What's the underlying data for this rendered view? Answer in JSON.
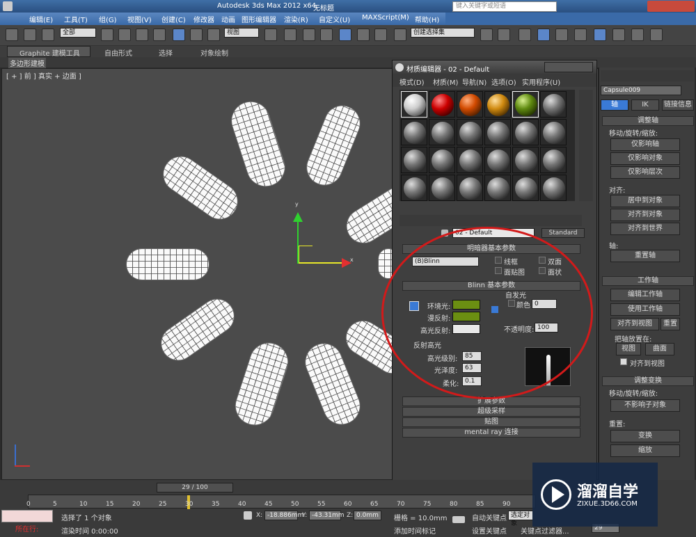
{
  "title": {
    "app": "Autodesk 3ds Max  2012 x64",
    "file": "无标题",
    "search_placeholder": "键入关键字或短语"
  },
  "menu": [
    "编辑(E)",
    "工具(T)",
    "组(G)",
    "视图(V)",
    "创建(C)",
    "修改器",
    "动画",
    "图形编辑器",
    "渲染(R)",
    "自定义(U)",
    "MAXScript(M)",
    "帮助(H)"
  ],
  "toolbar": {
    "selection_filter": "全部",
    "ref_coord": "视图",
    "named_selection": "创建选择集"
  },
  "ribbon": {
    "tabs": [
      "Graphite 建模工具",
      "自由形式",
      "选择",
      "对象绘制"
    ],
    "sub": "多边形建模"
  },
  "viewport": {
    "label": "[ + ] 前 ] 真实 + 边面 ]",
    "axis_x": "x",
    "axis_y": "y"
  },
  "mat_editor": {
    "title": "材质编辑器 - 02 - Default",
    "menu": [
      "模式(D)",
      "材质(M)",
      "导航(N)",
      "选项(O)",
      "实用程序(U)"
    ],
    "material_name": "02 - Default",
    "material_type": "Standard",
    "shader_rollout": "明暗器基本参数",
    "shader": "(B)Blinn",
    "wire": "线框",
    "two_sided": "双面",
    "face_map": "面贴图",
    "faceted": "面状",
    "blinn_rollout": "Blinn 基本参数",
    "self_illum": "自发光",
    "color": "颜色",
    "self_illum_value": "0",
    "ambient": "环境光:",
    "diffuse": "漫反射:",
    "specular": "高光反射:",
    "opacity_label": "不透明度:",
    "opacity": "100",
    "spec_highlights": "反射高光",
    "spec_level_label": "高光级别:",
    "spec_level": "85",
    "glossiness_label": "光泽度:",
    "glossiness": "63",
    "soften_label": "柔化:",
    "soften": "0.1",
    "rollouts": [
      "扩展参数",
      "超级采样",
      "贴图",
      "mental ray 连接"
    ],
    "ambient_color": "#6b8f12",
    "diffuse_color": "#6b8f12",
    "specular_color": "#e8e8e8"
  },
  "cmd_panel": {
    "object_name": "Capsule009",
    "tabs": [
      "轴",
      "IK",
      "链接信息"
    ],
    "adjust_pivot": "调整轴",
    "move_rotate_scale": "移动/旋转/缩放:",
    "affect_pivot_only": "仅影响轴",
    "affect_object_only": "仅影响对象",
    "affect_hierarchy_only": "仅影响层次",
    "alignment": "对齐:",
    "center_to_object": "居中到对象",
    "align_to_object": "对齐到对象",
    "align_to_world": "对齐到世界",
    "pivot": "轴:",
    "reset_pivot": "重置轴",
    "working_pivot": "工作轴",
    "edit_working_pivot": "编辑工作轴",
    "use_working_pivot": "使用工作轴",
    "align_to_view": "对齐到视图",
    "reset": "重置",
    "place_pivot_to": "把轴放置在:",
    "view": "视图",
    "surface": "曲面",
    "align_to_view_chk": "对齐到视图",
    "adjust_transform": "调整变换",
    "move_rotate_scale2": "移动/旋转/缩放:",
    "dont_affect_children": "不影响子对象",
    "reset2": "重置:",
    "transform": "变换",
    "scale": "缩放"
  },
  "timeline": {
    "frame": "29 / 100",
    "ticks": [
      "0",
      "5",
      "10",
      "15",
      "20",
      "25",
      "30",
      "35",
      "40",
      "45",
      "50",
      "55",
      "60",
      "65",
      "70",
      "75",
      "80",
      "85",
      "90"
    ]
  },
  "status": {
    "running": "所在行:",
    "selected": "选择了 1 个对象",
    "render_time": "渲染时间  0:00:00",
    "x": "-18.886mm",
    "y": "-43.31mm",
    "z": "0.0mm",
    "grid": "栅格 = 10.0mm",
    "add_time_tag": "添加时间标记",
    "auto_key": "自动关键点",
    "selected_obj": "选定对象",
    "set_key": "设置关键点",
    "key_filters": "关键点过滤器...",
    "frame_field": "29"
  },
  "watermark": {
    "brand": "溜溜自学",
    "url": "ZIXUE.3D66.COM"
  }
}
